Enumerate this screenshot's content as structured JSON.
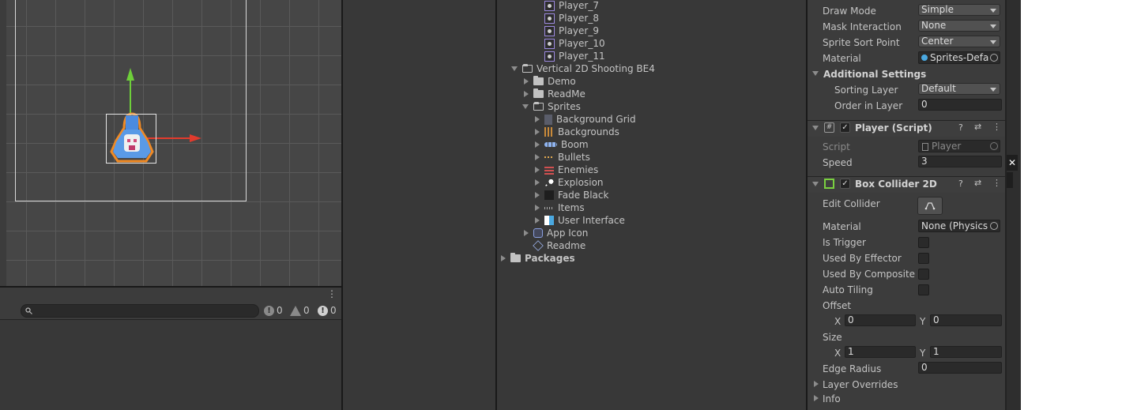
{
  "project_tree": {
    "items": [
      {
        "label": "Player_7",
        "kind": "sprite"
      },
      {
        "label": "Player_8",
        "kind": "sprite"
      },
      {
        "label": "Player_9",
        "kind": "sprite"
      },
      {
        "label": "Player_10",
        "kind": "sprite"
      },
      {
        "label": "Player_11",
        "kind": "sprite"
      },
      {
        "label": "Vertical 2D Shooting BE4",
        "kind": "folder-open"
      },
      {
        "label": "Demo",
        "kind": "folder"
      },
      {
        "label": "ReadMe",
        "kind": "folder"
      },
      {
        "label": "Sprites",
        "kind": "folder-open"
      },
      {
        "label": "Background Grid",
        "kind": "asset"
      },
      {
        "label": "Backgrounds",
        "kind": "asset"
      },
      {
        "label": "Boom",
        "kind": "asset"
      },
      {
        "label": "Bullets",
        "kind": "asset"
      },
      {
        "label": "Enemies",
        "kind": "asset"
      },
      {
        "label": "Explosion",
        "kind": "asset"
      },
      {
        "label": "Fade Black",
        "kind": "asset"
      },
      {
        "label": "Items",
        "kind": "asset"
      },
      {
        "label": "User Interface",
        "kind": "asset"
      },
      {
        "label": "App Icon",
        "kind": "asset"
      },
      {
        "label": "Readme",
        "kind": "asset"
      },
      {
        "label": "Packages",
        "kind": "folder"
      }
    ]
  },
  "console": {
    "log_count": "0",
    "warn_count": "0",
    "error_count": "0"
  },
  "inspector": {
    "sprite_renderer": {
      "draw_mode_label": "Draw Mode",
      "draw_mode_value": "Simple",
      "mask_label": "Mask Interaction",
      "mask_value": "None",
      "sort_point_label": "Sprite Sort Point",
      "sort_point_value": "Center",
      "material_label": "Material",
      "material_value": "Sprites-Defa",
      "additional_label": "Additional Settings",
      "sorting_layer_label": "Sorting Layer",
      "sorting_layer_value": "Default",
      "order_label": "Order in Layer",
      "order_value": "0"
    },
    "player_script": {
      "title": "Player (Script)",
      "script_label": "Script",
      "script_value": "Player",
      "speed_label": "Speed",
      "speed_value": "3"
    },
    "box_collider": {
      "title": "Box Collider 2D",
      "edit_label": "Edit Collider",
      "material_label": "Material",
      "material_value": "None (Physics",
      "trigger_label": "Is Trigger",
      "effector_label": "Used By Effector",
      "composite_label": "Used By Composite",
      "tiling_label": "Auto Tiling",
      "offset_label": "Offset",
      "offset_x": "0",
      "offset_y": "0",
      "size_label": "Size",
      "size_x": "1",
      "size_y": "1",
      "x_label": "X",
      "y_label": "Y",
      "edge_label": "Edge Radius",
      "edge_value": "0",
      "layer_overrides_label": "Layer Overrides",
      "info_label": "Info"
    }
  }
}
